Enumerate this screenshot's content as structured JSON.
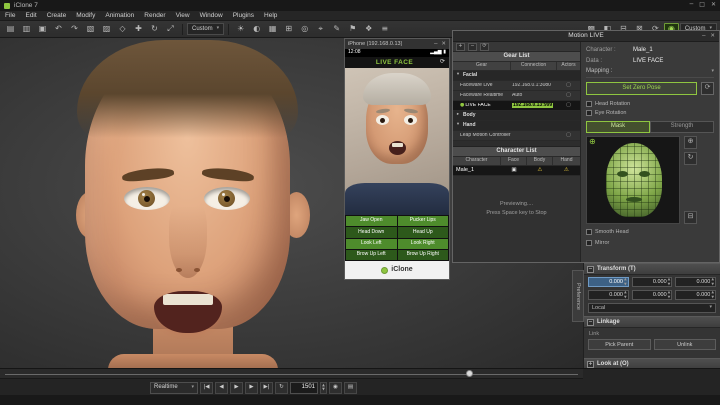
{
  "app": {
    "title": "iClone 7",
    "minimize": "─",
    "maximize": "□",
    "close": "✕"
  },
  "menu": {
    "items": [
      "File",
      "Edit",
      "Create",
      "Modify",
      "Animation",
      "Render",
      "View",
      "Window",
      "Plugins",
      "Help"
    ]
  },
  "toolbar": {
    "custom_left": "Custom",
    "custom_right": "Custom",
    "left": [
      {
        "n": "new-project-icon",
        "g": "▤"
      },
      {
        "n": "open-project-icon",
        "g": "▥"
      },
      {
        "n": "save-project-icon",
        "g": "▣"
      },
      {
        "n": "undo-icon",
        "g": "↶"
      },
      {
        "n": "redo-icon",
        "g": "↷"
      },
      {
        "n": "copy-icon",
        "g": "▧"
      },
      {
        "n": "paste-icon",
        "g": "▨"
      },
      {
        "n": "select-tool-icon",
        "g": "◇"
      },
      {
        "n": "move-tool-icon",
        "g": "✚"
      },
      {
        "n": "rotate-tool-icon",
        "g": "↻"
      },
      {
        "n": "scale-tool-icon",
        "g": "⤢"
      }
    ],
    "mid": [
      {
        "n": "sun-light-icon",
        "g": "☀"
      },
      {
        "n": "shadow-icon",
        "g": "◐"
      },
      {
        "n": "grid-icon",
        "g": "▦"
      },
      {
        "n": "snap-icon",
        "g": "⊞"
      },
      {
        "n": "camera-icon",
        "g": "◎"
      },
      {
        "n": "target-icon",
        "g": "⌖"
      },
      {
        "n": "edit-motion-icon",
        "g": "✎"
      },
      {
        "n": "flag-icon",
        "g": "⚑"
      },
      {
        "n": "gizmo-icon",
        "g": "❖"
      },
      {
        "n": "stage-list-icon",
        "g": "≡"
      }
    ],
    "right": [
      {
        "n": "scene-manager-icon",
        "g": "▩"
      },
      {
        "n": "content-manager-icon",
        "g": "◧"
      },
      {
        "n": "visual-settings-icon",
        "g": "⊟"
      },
      {
        "n": "render-icon",
        "g": "⊠"
      },
      {
        "n": "refresh-viewport-icon",
        "g": "⟳"
      },
      {
        "n": "motion-live-plugin-icon",
        "g": "◉",
        "active": true
      }
    ]
  },
  "phone": {
    "title": "iPhone (192.168.0.13)",
    "minimize": "─",
    "close": "✕",
    "time": "12:08",
    "status_icons": "▂▄▆ ▮",
    "app_title": "LIVE FACE",
    "camera_switch_icon": "⟳",
    "controls": [
      {
        "label": "Jaw Open",
        "tone": "bright"
      },
      {
        "label": "Pucker Lips",
        "tone": "bright"
      },
      {
        "label": "Head Down",
        "tone": "dark"
      },
      {
        "label": "Head Up",
        "tone": "dark"
      },
      {
        "label": "Look Left",
        "tone": "bright"
      },
      {
        "label": "Look Right",
        "tone": "bright"
      },
      {
        "label": "Brow Up Left",
        "tone": "dark"
      },
      {
        "label": "Brow Up Right",
        "tone": "dark"
      }
    ],
    "logo": "iClone"
  },
  "motion_live": {
    "title": "Motion LIVE",
    "minimize": "─",
    "close": "✕",
    "tools": [
      {
        "n": "add-gear-icon",
        "g": "+"
      },
      {
        "n": "remove-gear-icon",
        "g": "−"
      },
      {
        "n": "refresh-gears-icon",
        "g": "⟳"
      }
    ],
    "gear_list": {
      "title": "Gear List",
      "columns": [
        "Gear",
        "Connection",
        "Actors"
      ],
      "rows": [
        {
          "type": "group",
          "label": "Facial",
          "expanded": true
        },
        {
          "type": "gear",
          "name": "Faceware Live",
          "connection": "192.168.0.1:3080"
        },
        {
          "type": "gear",
          "name": "Faceware Realtime",
          "connection": "Auto"
        },
        {
          "type": "gear",
          "name": "LIVE FACE",
          "connection": "192.168.0.13:999",
          "active": true,
          "selected": true,
          "highlight": true
        },
        {
          "type": "group",
          "label": "Body",
          "expanded": false
        },
        {
          "type": "group",
          "label": "Hand",
          "expanded": true
        },
        {
          "type": "gear",
          "name": "Leap Motion Controller",
          "connection": ""
        }
      ]
    },
    "character_list": {
      "title": "Character List",
      "columns": [
        "Character",
        "Face",
        "Body",
        "Hand"
      ],
      "row": {
        "name": "Male_1"
      }
    },
    "status_line1": "Previewing....",
    "status_line2": "Press Space key to Stop",
    "settings": {
      "character_label": "Character :",
      "character_value": "Male_1",
      "data_label": "Data :",
      "data_value": "LIVE FACE",
      "mapping_label": "Mapping :",
      "zero_pose_button": "Set Zero Pose",
      "options": [
        {
          "label": "Head Rotation"
        },
        {
          "label": "Eye Rotation"
        }
      ],
      "tabs": [
        {
          "label": "Mask",
          "active": true
        },
        {
          "label": "Strength",
          "active": false
        }
      ],
      "preview_tools": [
        {
          "n": "focus-tool-icon",
          "g": "⊕"
        },
        {
          "n": "rotate-view-icon",
          "g": "↻"
        },
        {
          "n": "delete-map-icon",
          "g": "⊟"
        }
      ],
      "checkboxes": [
        {
          "label": "Smooth Head",
          "checked": false
        },
        {
          "label": "Mirror",
          "checked": false
        }
      ]
    }
  },
  "right_dock": {
    "preference_tab": "Preference",
    "transform": {
      "title": "Transform (T)",
      "rows": [
        {
          "values": [
            "0.000",
            "0.000",
            "0.000"
          ],
          "selected": 0
        },
        {
          "values": [
            "0.000",
            "0.000",
            "0.000"
          ],
          "selected": -1
        }
      ],
      "space_dropdown": "Local"
    },
    "linkage": {
      "title": "Linkage",
      "link_label": "Link",
      "buttons": [
        "Pick Parent",
        "Unlink"
      ]
    },
    "lookat_title": "Look at (O)"
  },
  "transport": {
    "mode": "Realtime",
    "frame": "1501",
    "buttons": [
      {
        "n": "go-to-start-icon",
        "g": "|◀"
      },
      {
        "n": "previous-frame-icon",
        "g": "◀"
      },
      {
        "n": "play-icon",
        "g": "▶"
      },
      {
        "n": "next-frame-icon",
        "g": "▶"
      },
      {
        "n": "go-to-end-icon",
        "g": "▶|"
      },
      {
        "n": "loop-icon",
        "g": "↻"
      }
    ],
    "tail_buttons": [
      {
        "n": "record-camera-icon",
        "g": "◉"
      },
      {
        "n": "clip-icon",
        "g": "▤"
      }
    ]
  },
  "icons": {
    "warning": "⚠",
    "face_check": "▣",
    "chevron_down": "▾",
    "dot": "●",
    "actor_box": "▢",
    "crosshair": "⊕"
  },
  "colors": {
    "accent_green": "#8fc640",
    "selected_blue": "#3d6185"
  }
}
